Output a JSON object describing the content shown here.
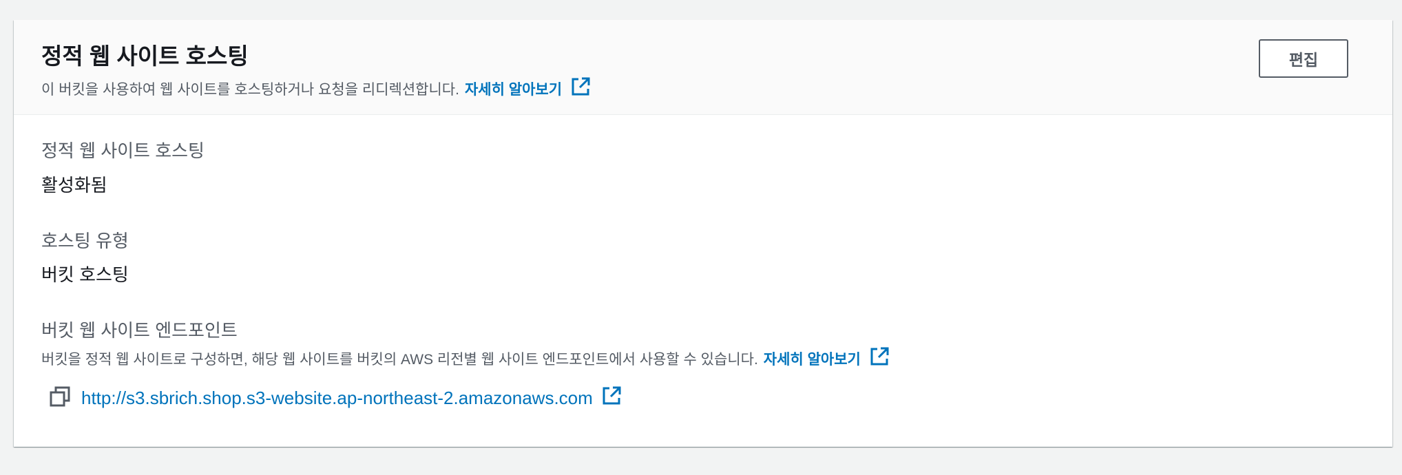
{
  "panel": {
    "title": "정적 웹 사이트 호스팅",
    "description": "이 버킷을 사용하여 웹 사이트를 호스팅하거나 요청을 리디렉션합니다.",
    "learn_more": "자세히 알아보기",
    "edit_button": "편집"
  },
  "fields": {
    "hosting": {
      "label": "정적 웹 사이트 호스팅",
      "value": "활성화됨"
    },
    "hosting_type": {
      "label": "호스팅 유형",
      "value": "버킷 호스팅"
    },
    "endpoint": {
      "label": "버킷 웹 사이트 엔드포인트",
      "description": "버킷을 정적 웹 사이트로 구성하면, 해당 웹 사이트를 버킷의 AWS 리전별 웹 사이트 엔드포인트에서 사용할 수 있습니다.",
      "learn_more": "자세히 알아보기",
      "url": "http://s3.sbrich.shop.s3-website.ap-northeast-2.amazonaws.com"
    }
  },
  "icons": {
    "external_link": "external-link-icon",
    "copy": "copy-icon"
  },
  "colors": {
    "link": "#0073bb",
    "page_background": "#f2f3f3",
    "header_background": "#fafafa",
    "secondary_text": "#545b64"
  }
}
